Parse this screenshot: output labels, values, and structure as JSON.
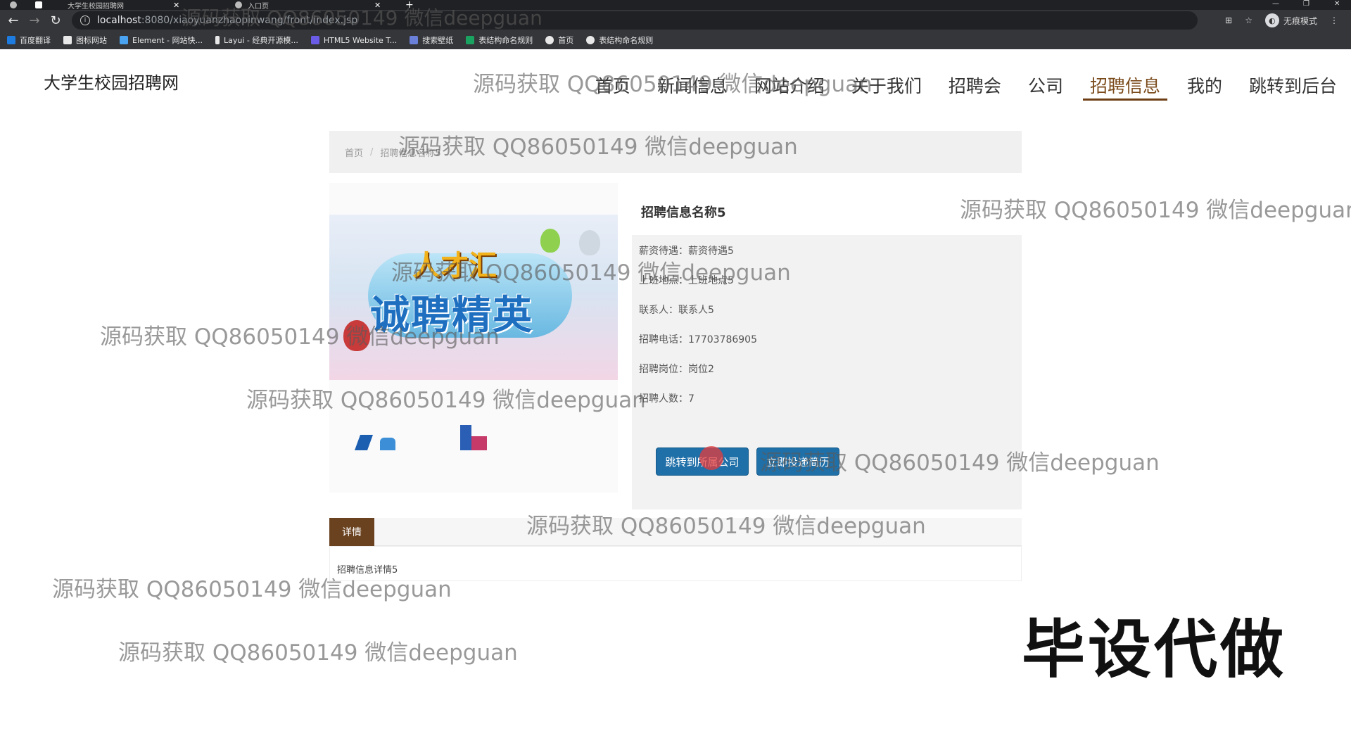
{
  "browser": {
    "tabs": [
      {
        "label": "大学生校园招聘网"
      },
      {
        "label": "入口页"
      }
    ],
    "url_host": "localhost",
    "url_path": ":8080/xiaoyuanzhaopinwang/front/index.jsp",
    "incognito_label": "无痕模式",
    "bookmarks": [
      {
        "label": "百度翻译",
        "color": "#1e7be0"
      },
      {
        "label": "图标网站",
        "color": "#e8e8e8"
      },
      {
        "label": "Element - 网站快...",
        "color": "#4aa3f0"
      },
      {
        "label": "Layui - 经典开源模...",
        "color": "#e8e8e8"
      },
      {
        "label": "HTML5 Website T...",
        "color": "#6b5ce7"
      },
      {
        "label": "搜索壁纸",
        "color": "#6a7fd8"
      },
      {
        "label": "表结构命名规则",
        "color": "#1aa260"
      },
      {
        "label": "首页",
        "color": "#e8e8e8"
      },
      {
        "label": "表结构命名规则",
        "color": "#e8e8e8"
      }
    ]
  },
  "site": {
    "title": "大学生校园招聘网",
    "nav": [
      {
        "label": "首页",
        "active": false
      },
      {
        "label": "新闻信息",
        "active": false
      },
      {
        "label": "网站介绍",
        "active": false
      },
      {
        "label": "关于我们",
        "active": false
      },
      {
        "label": "招聘会",
        "active": false
      },
      {
        "label": "公司",
        "active": false
      },
      {
        "label": "招聘信息",
        "active": true
      },
      {
        "label": "我的",
        "active": false
      },
      {
        "label": "跳转到后台",
        "active": false
      }
    ],
    "accent_color": "#6b4220"
  },
  "breadcrumb": {
    "home": "首页",
    "separator": "/",
    "current": "招聘信息名称5"
  },
  "banner": {
    "top_text": "人才汇",
    "main_text": "诚聘精英"
  },
  "job": {
    "title": "招聘信息名称5",
    "fields": [
      {
        "label": "薪资待遇：",
        "value": "薪资待遇5"
      },
      {
        "label": "上班地点：",
        "value": "上班地点5"
      },
      {
        "label": "联系人：",
        "value": "联系人5"
      },
      {
        "label": "招聘电话：",
        "value": "17703786905"
      },
      {
        "label": "招聘岗位：",
        "value": "岗位2"
      },
      {
        "label": "招聘人数：",
        "value": "7"
      }
    ],
    "btn_company": "跳转到所属公司",
    "btn_resume": "立即投递简历"
  },
  "details": {
    "tab_label": "详情",
    "content": "招聘信息详情5"
  },
  "watermark_text": "源码获取 QQ86050149 微信deepguan",
  "stamp_text": "毕设代做"
}
